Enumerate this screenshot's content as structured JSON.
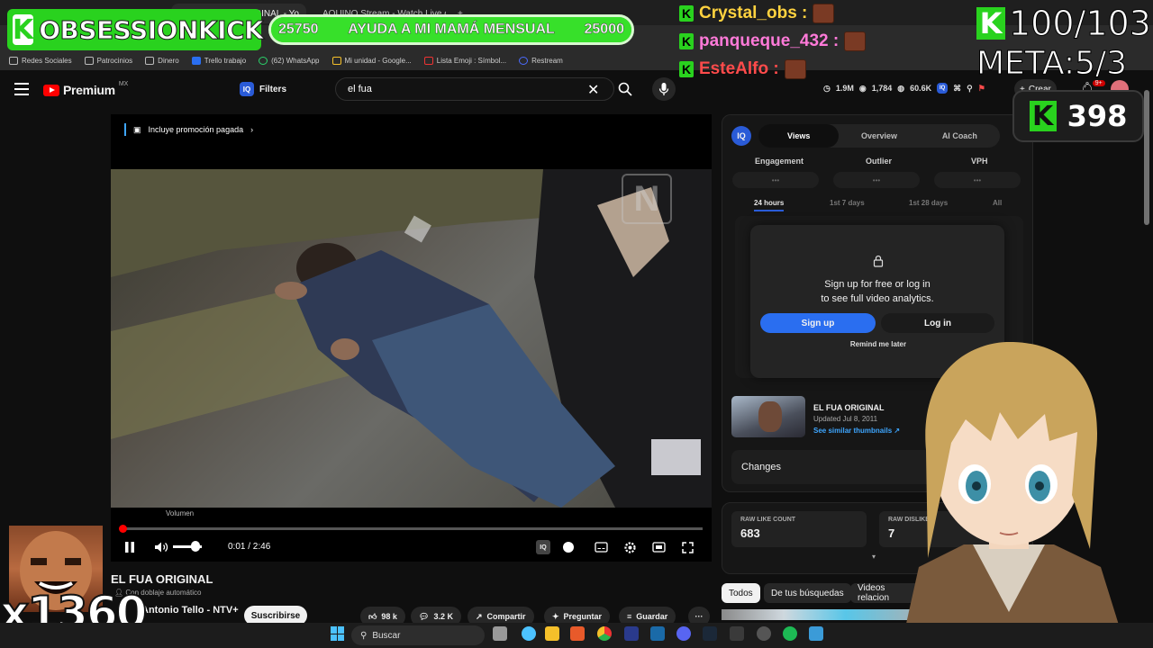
{
  "browser": {
    "tabs": [
      {
        "label": "(36) EL FUA ORIGINAL - Yo",
        "active": true
      },
      {
        "label": "AQUINO Stream - Watch Live o",
        "active": false
      }
    ],
    "bookmarks": [
      "Redes Sociales",
      "Patrocinios",
      "Dinero",
      "Trello trabajo",
      "(62) WhatsApp",
      "Mi unidad - Google...",
      "Lista Emoji : Símbol...",
      "Restream"
    ]
  },
  "overlay": {
    "channel_name": "OBSESSIONKICK",
    "goal": {
      "current": "25750",
      "label": "AYUDA A MI MAMÁ MENSUAL",
      "target": "25000",
      "progress": 1.0
    },
    "chat": [
      {
        "user": "Crystal_obs :",
        "color": "#ffd23f"
      },
      {
        "user": "panqueque_432 :",
        "color": "#ff7ad9"
      },
      {
        "user": "EsteAlfo :",
        "color": "#ff4b4b"
      }
    ],
    "counter": "100/103",
    "meta": "META:5/3",
    "kick_count": "398",
    "multiplier": "x1360"
  },
  "youtube": {
    "logo_text": "Premium",
    "region": "MX",
    "filters_label": "Filters",
    "iq_badge": "IQ",
    "search_value": "el fua",
    "stats": {
      "subs": "1.9M",
      "views": "1,784",
      "likes": "60.6K"
    },
    "create_label": "Crear",
    "notifications": "9+"
  },
  "player": {
    "promo": "Incluye promoción pagada",
    "volume_tooltip": "Volumen",
    "time": "0:01 / 2:46",
    "progress": 0.006,
    "volume": 0.65,
    "watermark": "N"
  },
  "video": {
    "title": "EL FUA ORIGINAL",
    "dub": "Con doblaje automático",
    "channel": "Antonio Tello - NTV+",
    "subscribe": "Suscribirse",
    "likes": "98 k",
    "comments": "3.2 K",
    "share": "Compartir",
    "ask": "Preguntar",
    "save": "Guardar",
    "more": "···"
  },
  "iq_panel": {
    "logo": "IQ",
    "tabs": [
      "Views",
      "Overview",
      "AI Coach"
    ],
    "active_tab": "Views",
    "metrics": [
      "Engagement",
      "Outlier",
      "VPH"
    ],
    "metric_placeholder": "•••",
    "ranges": [
      "24 hours",
      "1st 7 days",
      "1st 28 days",
      "All"
    ],
    "lock_line1": "Sign up for free or log in",
    "lock_line2": "to see full video analytics.",
    "signup": "Sign up",
    "login": "Log in",
    "remind": "Remind me later",
    "side_title": "EL FUA ORIGINAL",
    "side_updated": "Updated Jul 8, 2011",
    "side_similar": "See similar thumbnails ↗",
    "changes": "Changes",
    "raw_like_label": "RAW LIKE COUNT",
    "raw_like": "683",
    "raw_dislike_label": "RAW DISLIKE",
    "raw_dislike": "7"
  },
  "chips": [
    "Todos",
    "De tus búsquedas",
    "Videos relacion"
  ],
  "taskbar": {
    "search": "Buscar"
  }
}
